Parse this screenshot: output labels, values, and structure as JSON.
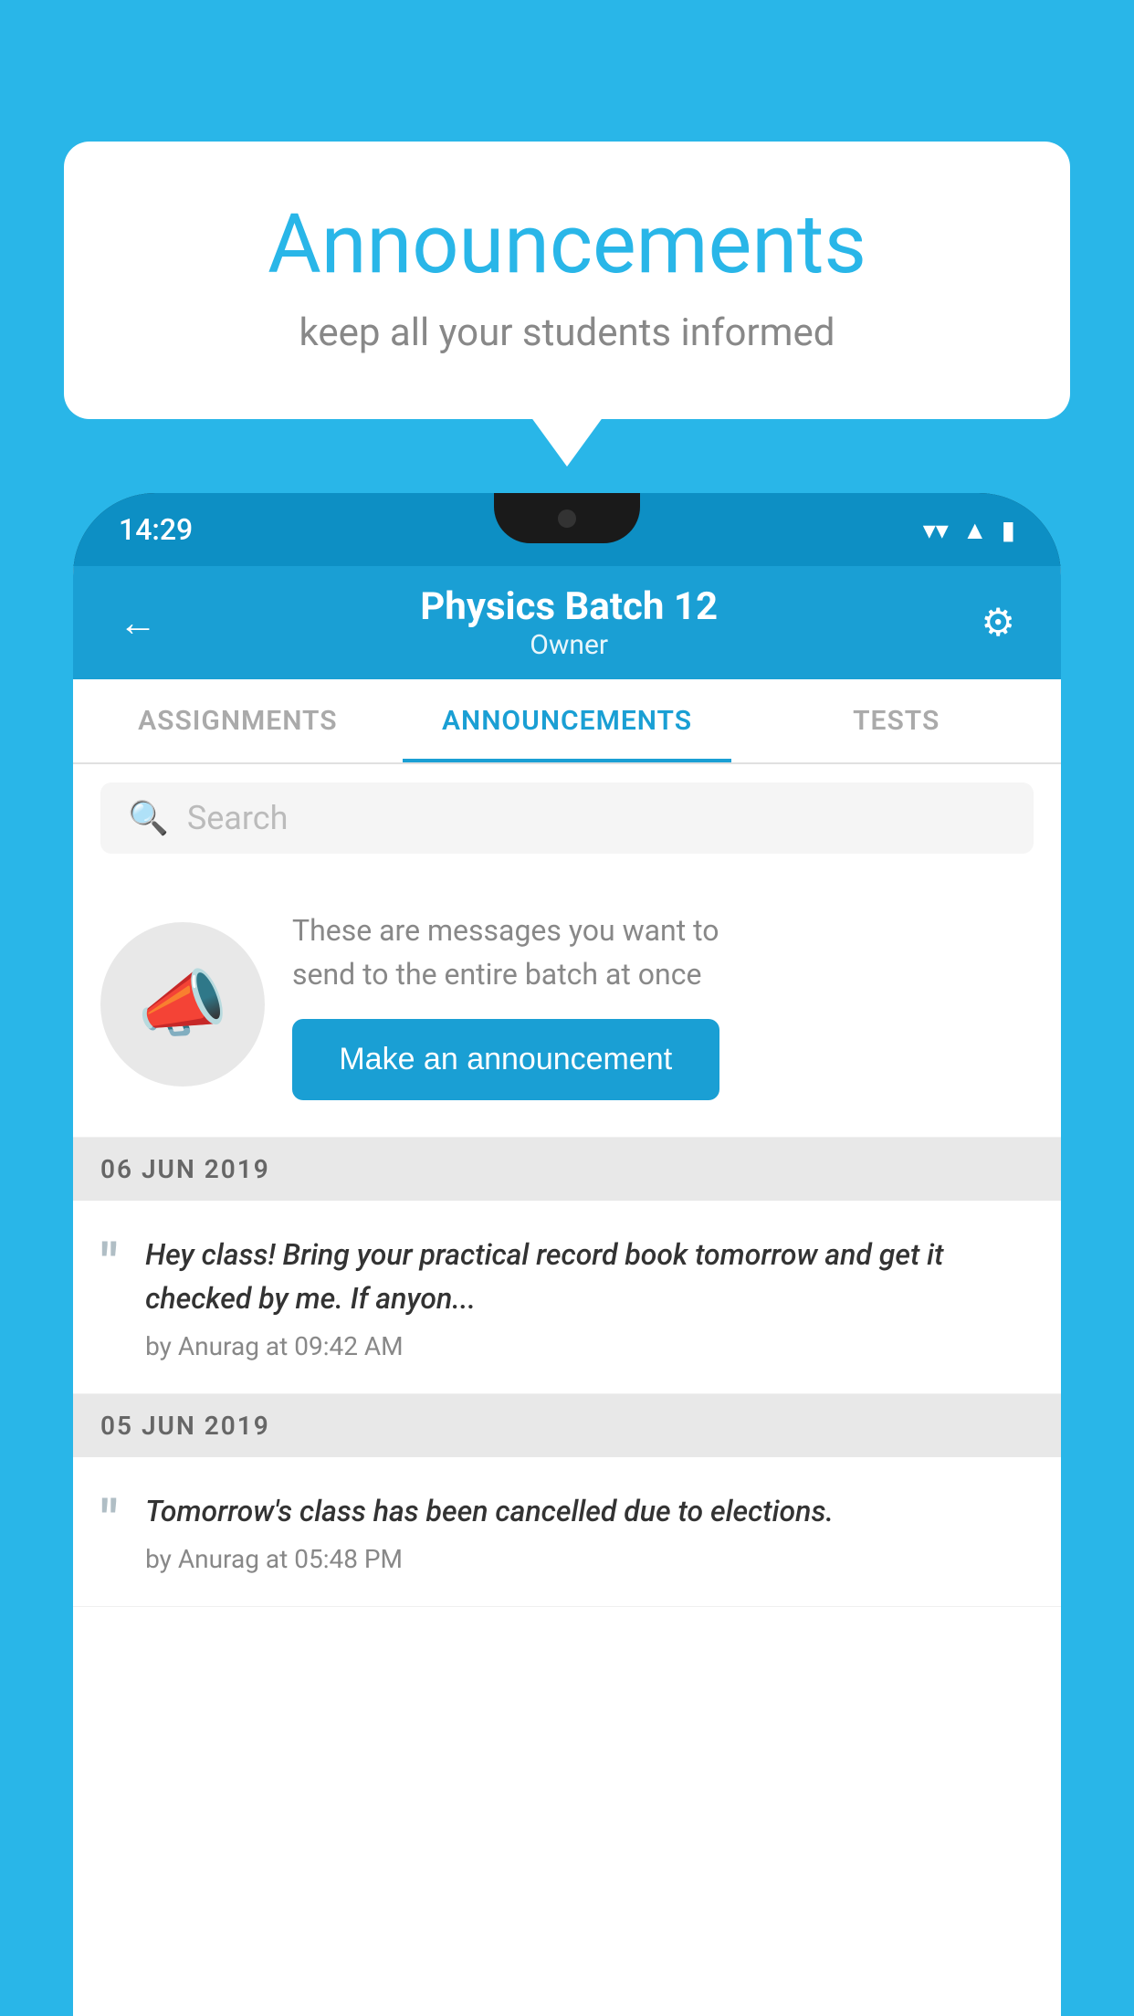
{
  "bubble": {
    "title": "Announcements",
    "subtitle": "keep all your students informed"
  },
  "statusBar": {
    "time": "14:29",
    "wifiIcon": "▼",
    "signalIcon": "▲",
    "batteryIcon": "▌"
  },
  "appHeader": {
    "title": "Physics Batch 12",
    "subtitle": "Owner",
    "backLabel": "←",
    "settingsLabel": "⚙"
  },
  "tabs": [
    {
      "label": "ASSIGNMENTS",
      "active": false
    },
    {
      "label": "ANNOUNCEMENTS",
      "active": true
    },
    {
      "label": "TESTS",
      "active": false
    }
  ],
  "searchBar": {
    "placeholder": "Search"
  },
  "announcementPrompt": {
    "descriptionLine1": "These are messages you want to",
    "descriptionLine2": "send to the entire batch at once",
    "buttonLabel": "Make an announcement"
  },
  "announcements": [
    {
      "date": "06  JUN  2019",
      "text": "Hey class! Bring your practical record book tomorrow and get it checked by me. If anyon...",
      "meta": "by Anurag at 09:42 AM"
    },
    {
      "date": "05  JUN  2019",
      "text": "Tomorrow's class has been cancelled due to elections.",
      "meta": "by Anurag at 05:48 PM"
    }
  ]
}
